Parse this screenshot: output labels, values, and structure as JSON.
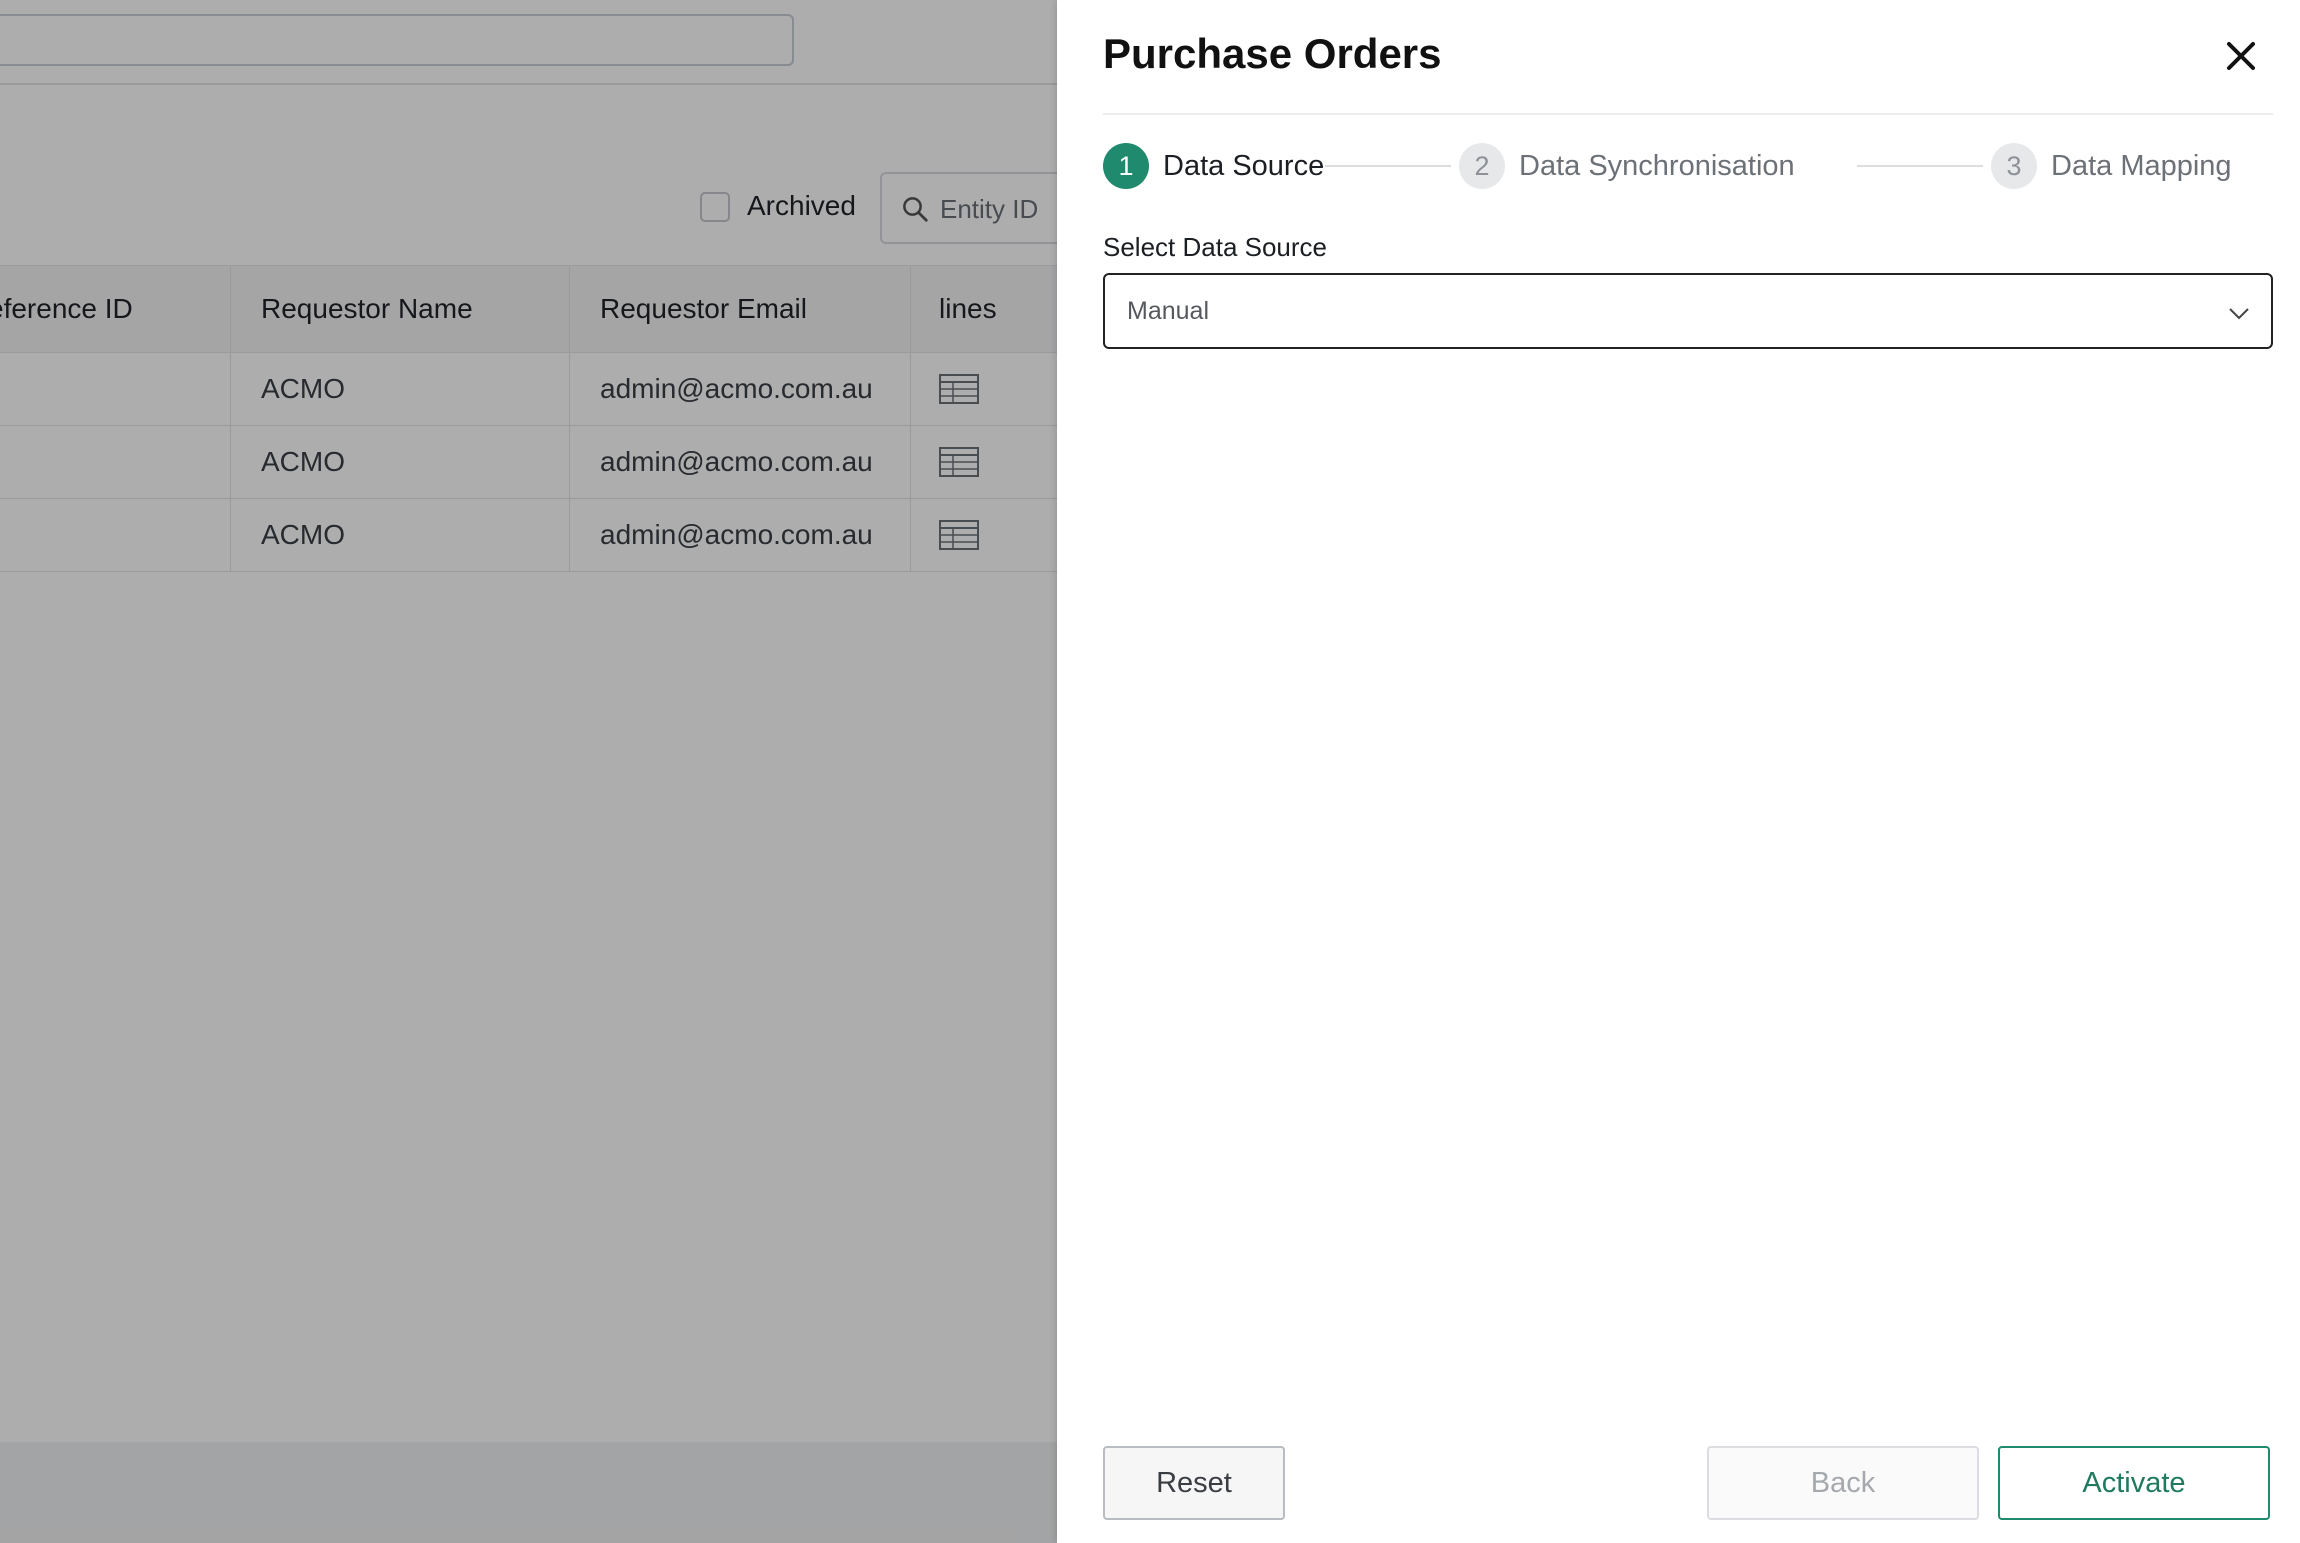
{
  "background": {
    "archived_label": "Archived",
    "entity_search_placeholder": "Entity ID",
    "table": {
      "headers": [
        "eference ID",
        "Requestor Name",
        "Requestor Email",
        "lines"
      ],
      "rows": [
        {
          "reference_id": "",
          "requestor_name": "ACMO",
          "requestor_email": "admin@acmo.com.au",
          "lines_icon": "table-icon"
        },
        {
          "reference_id": "",
          "requestor_name": "ACMO",
          "requestor_email": "admin@acmo.com.au",
          "lines_icon": "table-icon"
        },
        {
          "reference_id": "",
          "requestor_name": "ACMO",
          "requestor_email": "admin@acmo.com.au",
          "lines_icon": "table-icon"
        }
      ]
    }
  },
  "drawer": {
    "title": "Purchase Orders",
    "close_icon": "close-icon",
    "steps": [
      {
        "number": "1",
        "label": "Data Source",
        "state": "active"
      },
      {
        "number": "2",
        "label": "Data Synchronisation",
        "state": "inactive"
      },
      {
        "number": "3",
        "label": "Data Mapping",
        "state": "inactive"
      }
    ],
    "data_source": {
      "label": "Select Data Source",
      "selected": "Manual",
      "chevron_icon": "chevron-down-icon"
    },
    "buttons": {
      "reset": "Reset",
      "back": "Back",
      "activate": "Activate"
    }
  },
  "colors": {
    "accent": "#1f8a6e",
    "overlay": "rgba(0,0,0,0.32)"
  }
}
